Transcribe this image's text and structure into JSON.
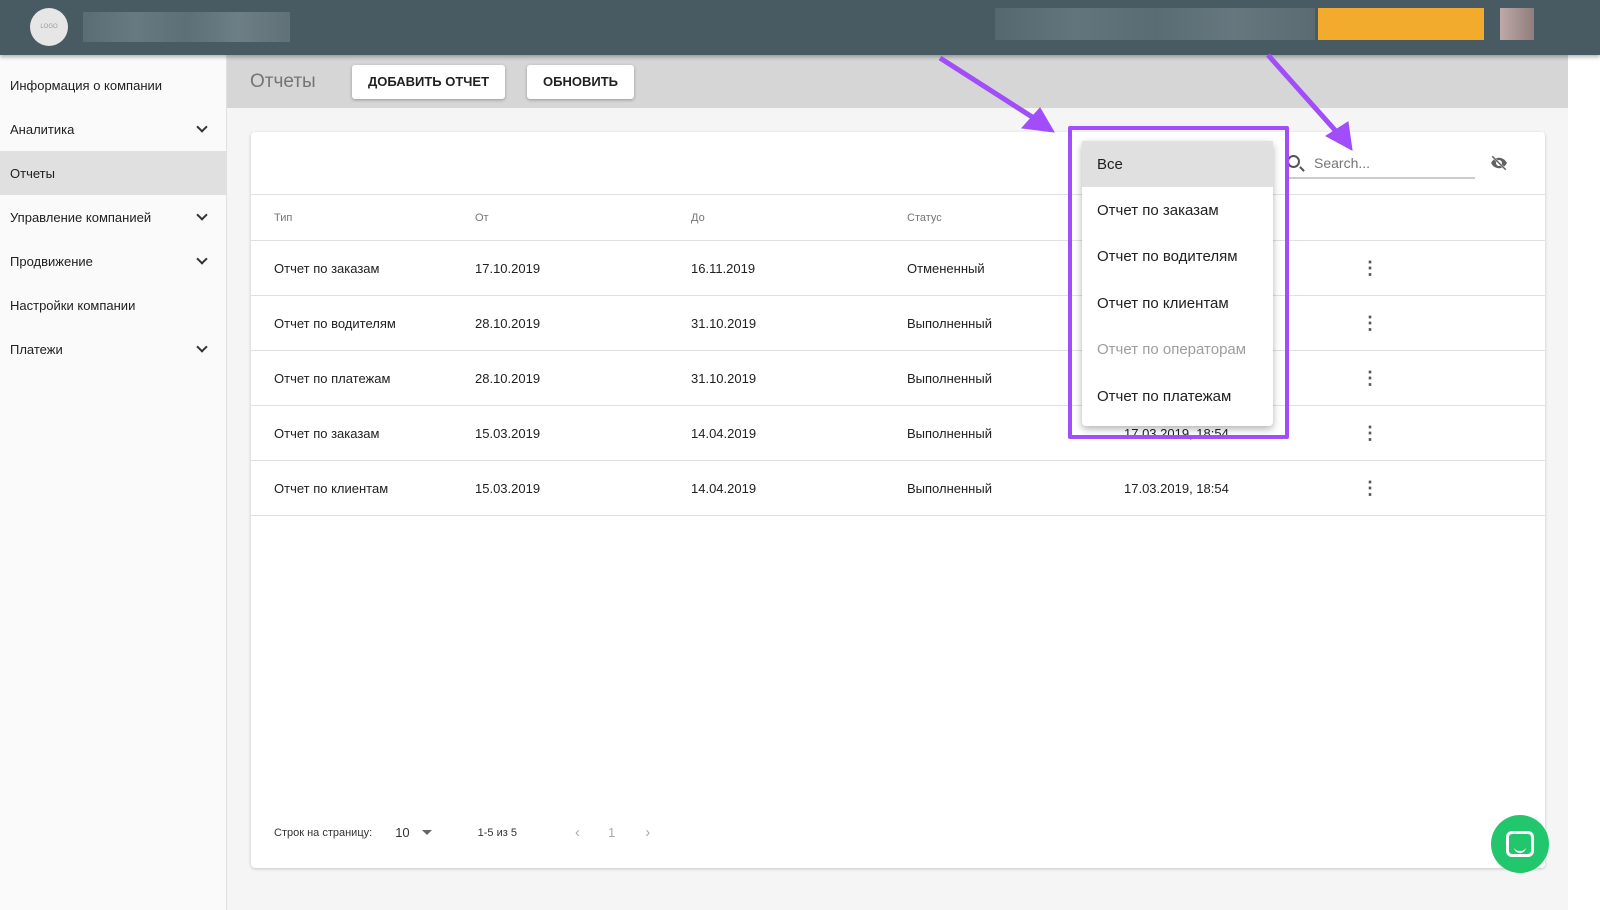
{
  "header": {
    "logo_text": "LOGO"
  },
  "sidebar": {
    "items": [
      {
        "label": "Информация о компании",
        "expandable": false,
        "active": false
      },
      {
        "label": "Аналитика",
        "expandable": true,
        "active": false
      },
      {
        "label": "Отчеты",
        "expandable": false,
        "active": true
      },
      {
        "label": "Управление компанией",
        "expandable": true,
        "active": false
      },
      {
        "label": "Продвижение",
        "expandable": true,
        "active": false
      },
      {
        "label": "Настройки компании",
        "expandable": false,
        "active": false
      },
      {
        "label": "Платежи",
        "expandable": true,
        "active": false
      }
    ]
  },
  "toolbar": {
    "title": "Отчеты",
    "add_label": "ДОБАВИТЬ ОТЧЕТ",
    "refresh_label": "ОБНОВИТЬ"
  },
  "search": {
    "placeholder": "Search..."
  },
  "table": {
    "headers": [
      "Тип",
      "От",
      "До",
      "Статус",
      ""
    ],
    "rows": [
      [
        "Отчет по заказам",
        "17.10.2019",
        "16.11.2019",
        "Отмененный",
        ""
      ],
      [
        "Отчет по водителям",
        "28.10.2019",
        "31.10.2019",
        "Выполненный",
        ""
      ],
      [
        "Отчет по платежам",
        "28.10.2019",
        "31.10.2019",
        "Выполненный",
        ""
      ],
      [
        "Отчет по заказам",
        "15.03.2019",
        "14.04.2019",
        "Выполненный",
        "17.03.2019, 18:54"
      ],
      [
        "Отчет по клиентам",
        "15.03.2019",
        "14.04.2019",
        "Выполненный",
        "17.03.2019, 18:54"
      ]
    ]
  },
  "pagination": {
    "rows_label": "Строк на страницу:",
    "rows_value": "10",
    "range": "1-5 из 5",
    "page": "1"
  },
  "dropdown": {
    "items": [
      {
        "label": "Все",
        "selected": true,
        "disabled": false
      },
      {
        "label": "Отчет по заказам",
        "selected": false,
        "disabled": false
      },
      {
        "label": "Отчет по водителям",
        "selected": false,
        "disabled": false
      },
      {
        "label": "Отчет по клиентам",
        "selected": false,
        "disabled": false
      },
      {
        "label": "Отчет по операторам",
        "selected": false,
        "disabled": true
      },
      {
        "label": "Отчет по платежам",
        "selected": false,
        "disabled": false
      }
    ]
  },
  "colors": {
    "header": "#485a62",
    "highlight": "#a14dfa",
    "chat": "#22c76d",
    "accent_orange": "#f2ab2d"
  }
}
